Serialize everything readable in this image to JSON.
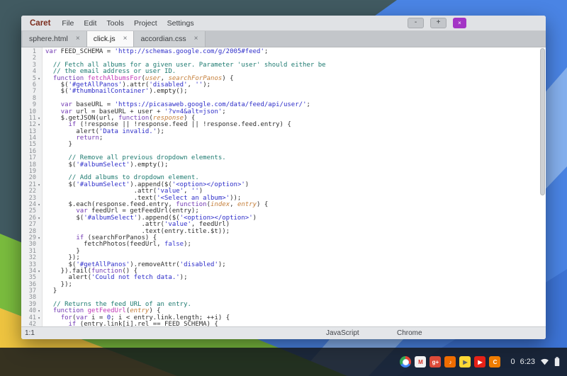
{
  "window": {
    "app_title": "Caret",
    "menus": [
      "File",
      "Edit",
      "Tools",
      "Project",
      "Settings"
    ],
    "controls": {
      "minimize": "-",
      "maximize": "+",
      "close": "×"
    }
  },
  "tabs": [
    {
      "label": "sphere.html",
      "active": false
    },
    {
      "label": "click.js",
      "active": true
    },
    {
      "label": "accordian.css",
      "active": false
    }
  ],
  "status_bar": {
    "cursor": "1:1",
    "syntax": "JavaScript",
    "theme": "Chrome"
  },
  "colors": {
    "close_button": "#a335c5",
    "title_text": "#7b2c1d",
    "syntax": {
      "k": "#7239b3",
      "s": "#2d2dc9",
      "c": "#1d7a70",
      "f": "#c238b8",
      "a": "#c57f3a",
      "n": "#1f1fc4",
      "b": "#3b3bd0",
      "p": "#2e2e2e"
    }
  },
  "editor": {
    "token_legend": {
      "k": "keyword",
      "s": "string",
      "c": "comment",
      "f": "function-name",
      "a": "parameter",
      "n": "number",
      "b": "constant",
      "p": "plain"
    },
    "lines": [
      {
        "n": 1,
        "s": [
          [
            "k",
            "var"
          ],
          [
            "p",
            " FEED_SCHEMA = "
          ],
          [
            "s",
            "'http://schemas.google.com/g/2005#feed'"
          ],
          [
            "p",
            ";"
          ]
        ]
      },
      {
        "n": 2,
        "s": []
      },
      {
        "n": 3,
        "s": [
          [
            "c",
            "  // Fetch all albums for a given user. Parameter 'user' should either be"
          ]
        ]
      },
      {
        "n": 4,
        "s": [
          [
            "c",
            "  // the email address or user ID."
          ]
        ]
      },
      {
        "n": 5,
        "fold": true,
        "s": [
          [
            "p",
            "  "
          ],
          [
            "k",
            "function"
          ],
          [
            "p",
            " "
          ],
          [
            "f",
            "fetchAlbumsFor"
          ],
          [
            "p",
            "("
          ],
          [
            "a",
            "user"
          ],
          [
            "p",
            ", "
          ],
          [
            "a",
            "searchForPanos"
          ],
          [
            "p",
            ") {"
          ]
        ]
      },
      {
        "n": 6,
        "s": [
          [
            "p",
            "    $("
          ],
          [
            "s",
            "'#getAllPanos'"
          ],
          [
            "p",
            ").attr("
          ],
          [
            "s",
            "'disabled'"
          ],
          [
            "p",
            ", "
          ],
          [
            "s",
            "''"
          ],
          [
            "p",
            ");"
          ]
        ]
      },
      {
        "n": 7,
        "s": [
          [
            "p",
            "    $("
          ],
          [
            "s",
            "'#thumbnailContainer'"
          ],
          [
            "p",
            ").empty();"
          ]
        ]
      },
      {
        "n": 8,
        "s": []
      },
      {
        "n": 9,
        "s": [
          [
            "p",
            "    "
          ],
          [
            "k",
            "var"
          ],
          [
            "p",
            " baseURL = "
          ],
          [
            "s",
            "'https://picasaweb.google.com/data/feed/api/user/'"
          ],
          [
            "p",
            ";"
          ]
        ]
      },
      {
        "n": 10,
        "s": [
          [
            "p",
            "    "
          ],
          [
            "k",
            "var"
          ],
          [
            "p",
            " url = baseURL + user + "
          ],
          [
            "s",
            "'?v=4&alt=json'"
          ],
          [
            "p",
            ";"
          ]
        ]
      },
      {
        "n": 11,
        "fold": true,
        "s": [
          [
            "p",
            "    $.getJSON(url, "
          ],
          [
            "k",
            "function"
          ],
          [
            "p",
            "("
          ],
          [
            "a",
            "response"
          ],
          [
            "p",
            ") {"
          ]
        ]
      },
      {
        "n": 12,
        "fold": true,
        "s": [
          [
            "p",
            "      "
          ],
          [
            "k",
            "if"
          ],
          [
            "p",
            " (!response || !response.feed || !response.feed.entry) {"
          ]
        ]
      },
      {
        "n": 13,
        "s": [
          [
            "p",
            "        alert("
          ],
          [
            "s",
            "'Data invalid.'"
          ],
          [
            "p",
            ");"
          ]
        ]
      },
      {
        "n": 14,
        "s": [
          [
            "p",
            "        "
          ],
          [
            "k",
            "return"
          ],
          [
            "p",
            ";"
          ]
        ]
      },
      {
        "n": 15,
        "s": [
          [
            "p",
            "      }"
          ]
        ]
      },
      {
        "n": 16,
        "s": []
      },
      {
        "n": 17,
        "s": [
          [
            "c",
            "      // Remove all previous dropdown elements."
          ]
        ]
      },
      {
        "n": 18,
        "s": [
          [
            "p",
            "      $("
          ],
          [
            "s",
            "'#albumSelect'"
          ],
          [
            "p",
            ").empty();"
          ]
        ]
      },
      {
        "n": 19,
        "s": []
      },
      {
        "n": 20,
        "s": [
          [
            "c",
            "      // Add albums to dropdown element."
          ]
        ]
      },
      {
        "n": 21,
        "fold": true,
        "s": [
          [
            "p",
            "      $("
          ],
          [
            "s",
            "'#albumSelect'"
          ],
          [
            "p",
            ").append($("
          ],
          [
            "s",
            "'<option></option>'"
          ],
          [
            "p",
            ")"
          ]
        ]
      },
      {
        "n": 22,
        "s": [
          [
            "p",
            "                       .attr("
          ],
          [
            "s",
            "'value'"
          ],
          [
            "p",
            ", "
          ],
          [
            "s",
            "''"
          ],
          [
            "p",
            ")"
          ]
        ]
      },
      {
        "n": 23,
        "s": [
          [
            "p",
            "                       .text("
          ],
          [
            "s",
            "'<Select an album>'"
          ],
          [
            "p",
            "));"
          ]
        ]
      },
      {
        "n": 24,
        "fold": true,
        "s": [
          [
            "p",
            "      $.each(response.feed.entry, "
          ],
          [
            "k",
            "function"
          ],
          [
            "p",
            "("
          ],
          [
            "a",
            "index"
          ],
          [
            "p",
            ", "
          ],
          [
            "a",
            "entry"
          ],
          [
            "p",
            ") {"
          ]
        ]
      },
      {
        "n": 25,
        "s": [
          [
            "p",
            "        "
          ],
          [
            "k",
            "var"
          ],
          [
            "p",
            " feedUrl = getFeedUrl(entry);"
          ]
        ]
      },
      {
        "n": 26,
        "fold": true,
        "s": [
          [
            "p",
            "        $("
          ],
          [
            "s",
            "'#albumSelect'"
          ],
          [
            "p",
            ").append($("
          ],
          [
            "s",
            "'<option></option>'"
          ],
          [
            "p",
            ")"
          ]
        ]
      },
      {
        "n": 27,
        "s": [
          [
            "p",
            "                         .attr("
          ],
          [
            "s",
            "'value'"
          ],
          [
            "p",
            ", feedUrl)"
          ]
        ]
      },
      {
        "n": 28,
        "s": [
          [
            "p",
            "                         .text(entry.title.$t));"
          ]
        ]
      },
      {
        "n": 29,
        "fold": true,
        "s": [
          [
            "p",
            "        "
          ],
          [
            "k",
            "if"
          ],
          [
            "p",
            " (searchForPanos) {"
          ]
        ]
      },
      {
        "n": 30,
        "s": [
          [
            "p",
            "          fetchPhotos(feedUrl, "
          ],
          [
            "b",
            "false"
          ],
          [
            "p",
            ");"
          ]
        ]
      },
      {
        "n": 31,
        "s": [
          [
            "p",
            "        }"
          ]
        ]
      },
      {
        "n": 32,
        "s": [
          [
            "p",
            "      });"
          ]
        ]
      },
      {
        "n": 33,
        "s": [
          [
            "p",
            "      $("
          ],
          [
            "s",
            "'#getAllPanos'"
          ],
          [
            "p",
            ").removeAttr("
          ],
          [
            "s",
            "'disabled'"
          ],
          [
            "p",
            ");"
          ]
        ]
      },
      {
        "n": 34,
        "fold": true,
        "s": [
          [
            "p",
            "    }).fail("
          ],
          [
            "k",
            "function"
          ],
          [
            "p",
            "() {"
          ]
        ]
      },
      {
        "n": 35,
        "s": [
          [
            "p",
            "      alert("
          ],
          [
            "s",
            "'Could not fetch data.'"
          ],
          [
            "p",
            ");"
          ]
        ]
      },
      {
        "n": 36,
        "s": [
          [
            "p",
            "    });"
          ]
        ]
      },
      {
        "n": 37,
        "s": [
          [
            "p",
            "  }"
          ]
        ]
      },
      {
        "n": 38,
        "s": []
      },
      {
        "n": 39,
        "s": [
          [
            "c",
            "  // Returns the feed URL of an entry."
          ]
        ]
      },
      {
        "n": 40,
        "fold": true,
        "s": [
          [
            "p",
            "  "
          ],
          [
            "k",
            "function"
          ],
          [
            "p",
            " "
          ],
          [
            "f",
            "getFeedUrl"
          ],
          [
            "p",
            "("
          ],
          [
            "a",
            "entry"
          ],
          [
            "p",
            ") {"
          ]
        ]
      },
      {
        "n": 41,
        "fold": true,
        "s": [
          [
            "p",
            "    "
          ],
          [
            "k",
            "for"
          ],
          [
            "p",
            "("
          ],
          [
            "k",
            "var"
          ],
          [
            "p",
            " i = "
          ],
          [
            "n",
            "0"
          ],
          [
            "p",
            "; i < entry.link.length; ++i) {"
          ]
        ]
      },
      {
        "n": 42,
        "s": [
          [
            "p",
            "      "
          ],
          [
            "k",
            "if"
          ],
          [
            "p",
            " (entry.link[i].rel == FEED_SCHEMA) {"
          ]
        ]
      }
    ]
  },
  "shelf": {
    "apps": [
      {
        "id": "chrome",
        "glyph": ""
      },
      {
        "id": "gmail",
        "glyph": "M",
        "bg": "#f1f1f1",
        "fg": "#d93025"
      },
      {
        "id": "gplus",
        "glyph": "g+",
        "bg": "#dd4b39",
        "fg": "#ffffff"
      },
      {
        "id": "play-music",
        "glyph": "♪",
        "bg": "#ef6c00",
        "fg": "#ffffff"
      },
      {
        "id": "play-store",
        "glyph": "▶",
        "bg": "#fdd835",
        "fg": "#5f6368"
      },
      {
        "id": "youtube",
        "glyph": "▶",
        "bg": "#e62117",
        "fg": "#ffffff"
      },
      {
        "id": "caret",
        "glyph": "C",
        "bg": "#ef7c00",
        "fg": "#ffffff"
      }
    ],
    "tray": {
      "badge": "0",
      "time": "6:23"
    }
  }
}
